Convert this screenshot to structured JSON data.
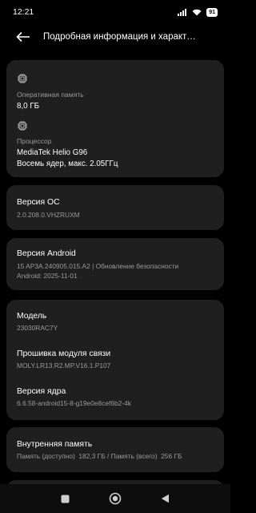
{
  "status_bar": {
    "time": "12:21",
    "battery": "91"
  },
  "app_bar": {
    "title": "Подробная информация и характ…"
  },
  "memory": {
    "label": "Оперативная память",
    "value": "8,0 ГБ"
  },
  "processor": {
    "label": "Процессор",
    "name": "MediaTek Helio G96",
    "detail": "Восемь ядер, макс. 2.05ГГц"
  },
  "os_version": {
    "title": "Версия ОС",
    "value": "2.0.208.0.VHZRUXM"
  },
  "android_version": {
    "title": "Версия Android",
    "line1": "15 AP3A.240905.015.A2 | Обновление безопасности",
    "line2": "Android: 2025-11-01"
  },
  "model": {
    "title": "Модель",
    "value": "23030RAC7Y"
  },
  "firmware": {
    "title": "Прошивка модуля связи",
    "value": "MOLY.LR13.R2.MP.V16.1.P107"
  },
  "kernel": {
    "title": "Версия ядра",
    "value": "6.6.58-android15-8-g19e0e8cef6b2-4k"
  },
  "storage": {
    "title": "Внутренняя память",
    "value": "Память (доступно)  182,3 ГБ / Память (всего)  256 ГБ"
  },
  "icons": {
    "back": "arrow-left-icon",
    "chip": "chip-icon",
    "wifi": "wifi-icon",
    "signal": "signal-icon",
    "home": "home-circle-icon",
    "recents": "recents-square-icon",
    "nav_back": "back-triangle-icon"
  },
  "colors": {
    "background": "#000000",
    "card": "#1f1f1f",
    "secondary_text": "#9a9a9a"
  }
}
